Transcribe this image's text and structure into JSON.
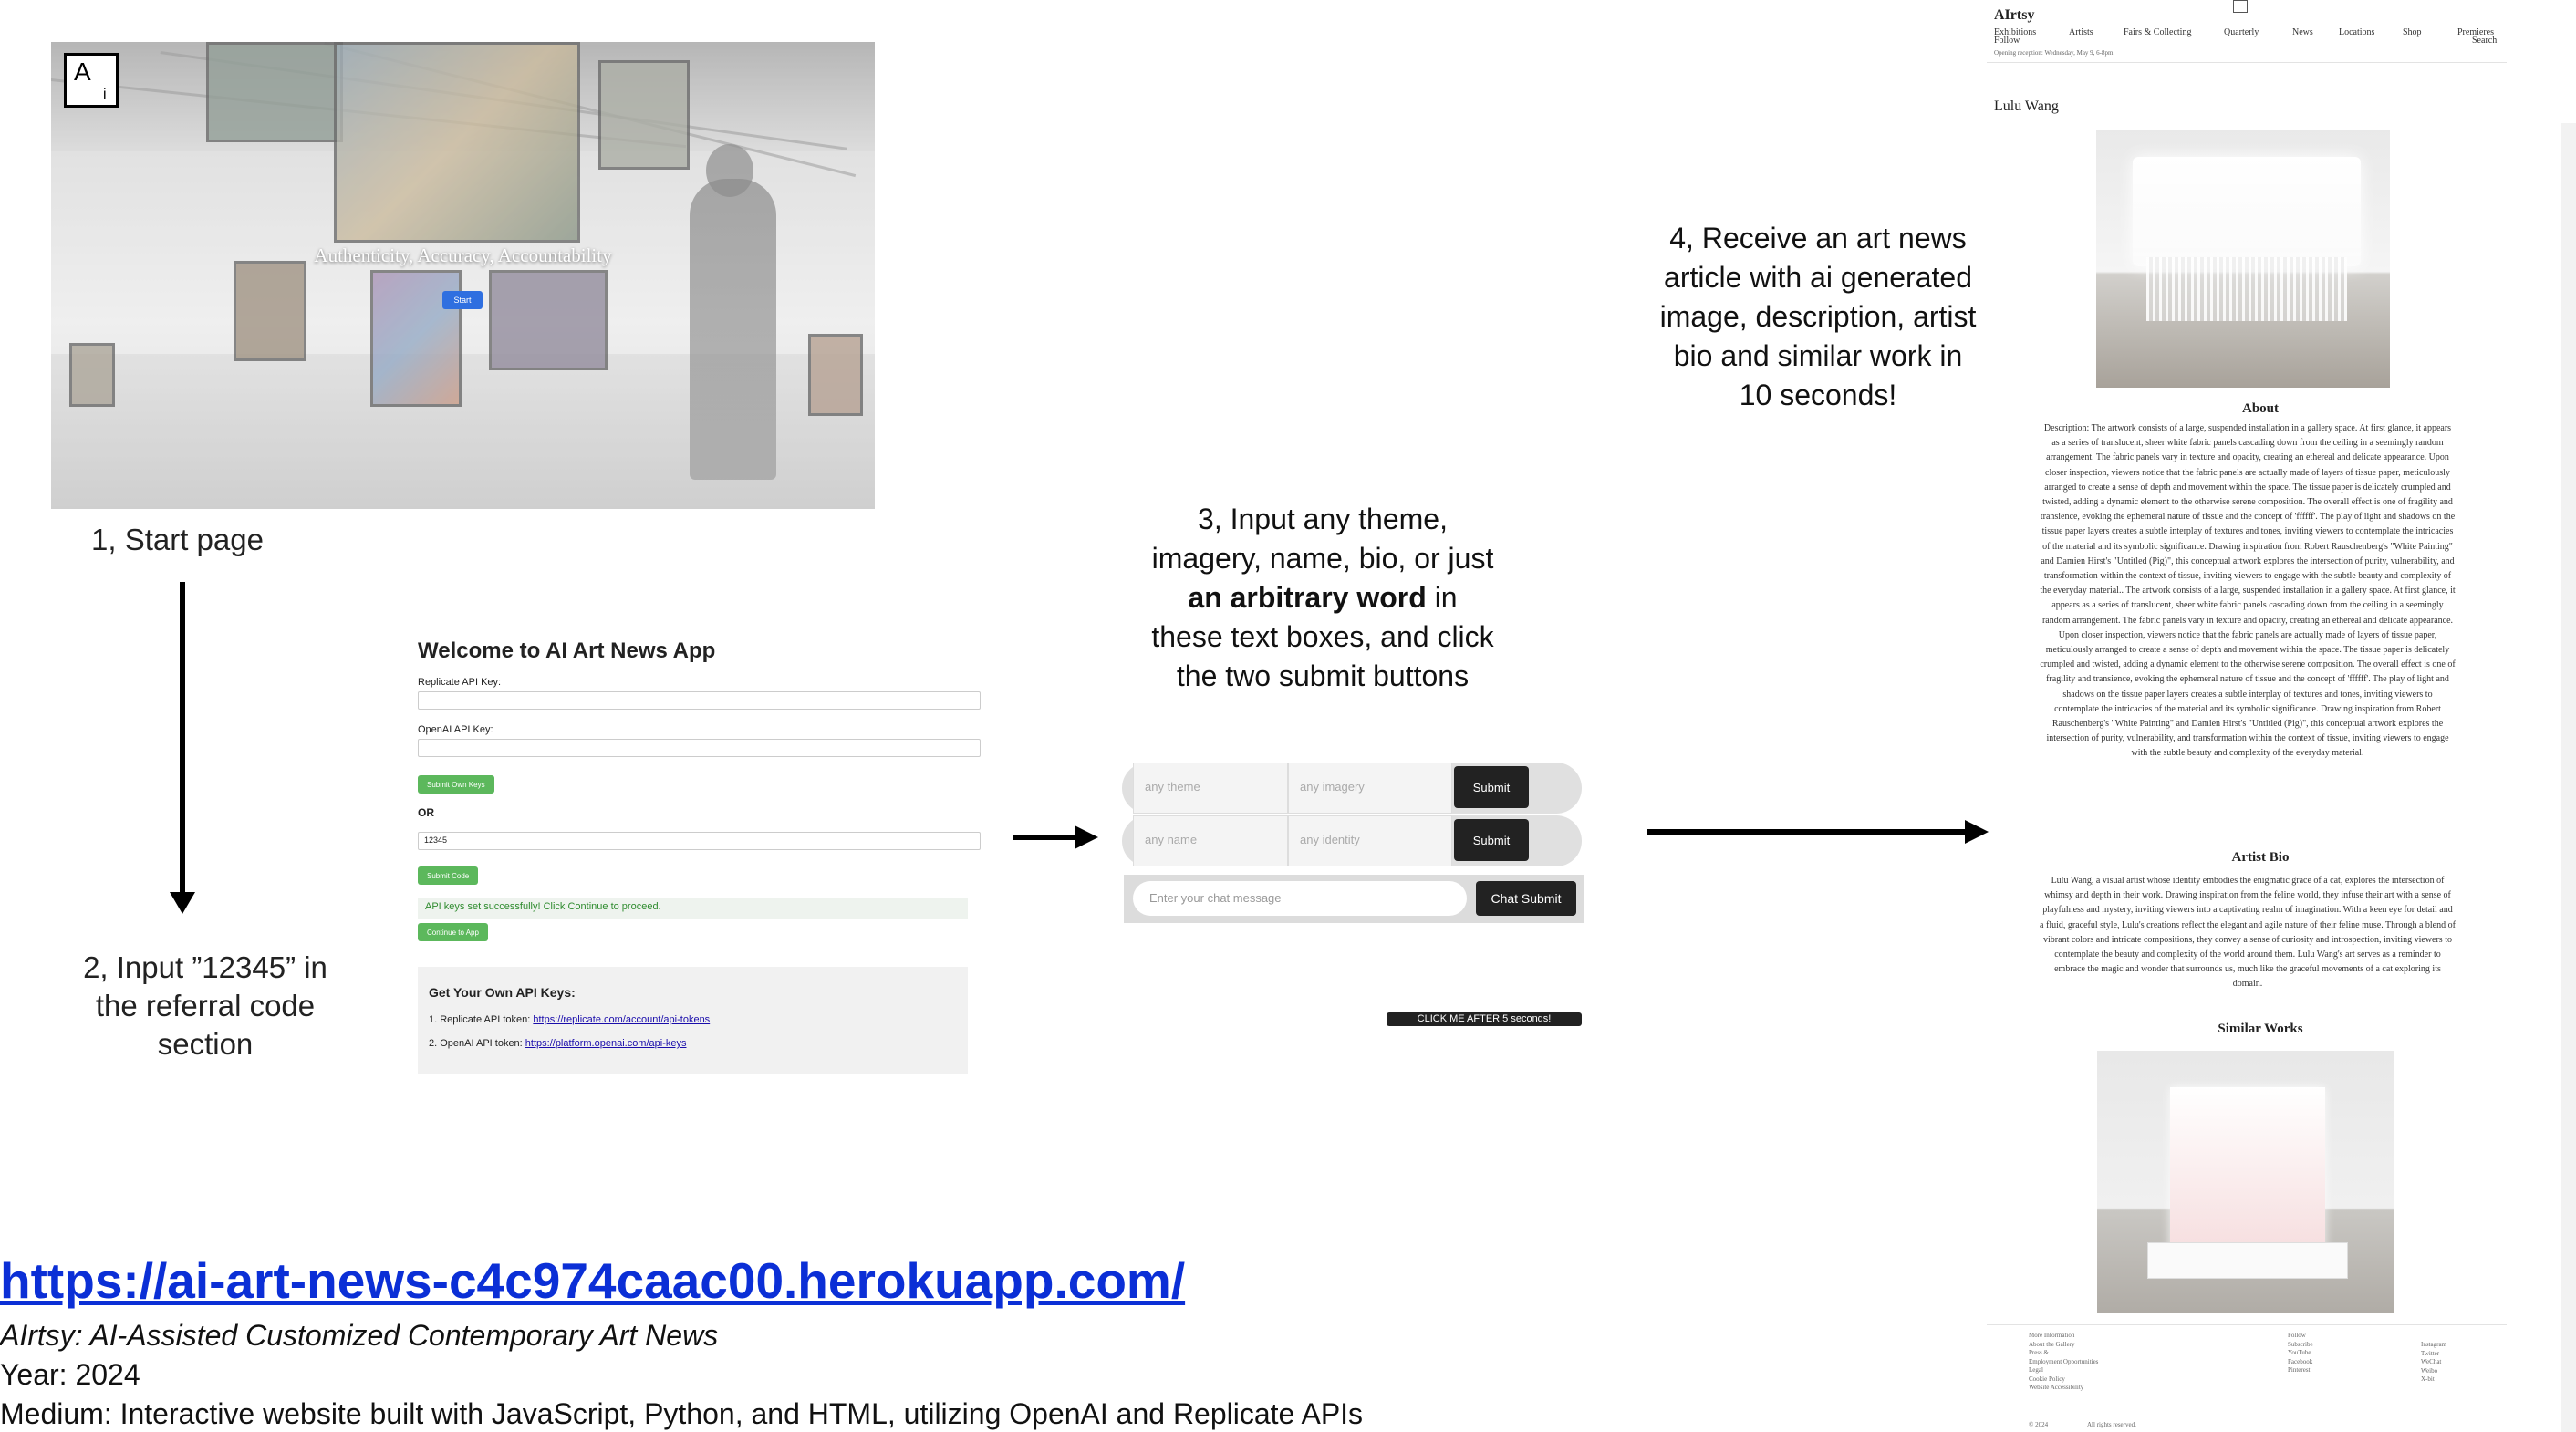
{
  "start_page": {
    "logo_main": "A",
    "logo_sub": "i",
    "tagline": "Authenticity, Accuracy, Accountability",
    "start_button": "Start"
  },
  "captions": {
    "step1": "1, Start page",
    "step2": "2, Input ”12345” in the referral code section",
    "step3_pre": "3, Input any theme, imagery, name, bio, or just",
    "step3_bold": "an arbitrary word",
    "step3_post": "in these text boxes, and click the two submit buttons",
    "step4": "4, Receive an art news article with ai generated image, description, artist bio and similar work in 10 seconds!"
  },
  "api_form": {
    "title": "Welcome to AI Art News App",
    "replicate_label": "Replicate API Key:",
    "openai_label": "OpenAI API Key:",
    "submit_own_keys": "Submit Own Keys",
    "or": "OR",
    "referral_value": "12345",
    "submit_code": "Submit Code",
    "success_message": "API keys set successfully! Click Continue to proceed.",
    "continue_button": "Continue to App",
    "get_keys_title": "Get Your Own API Keys:",
    "replicate_token_text": "1. Replicate API token:",
    "replicate_token_link": "https://replicate.com/account/api-tokens",
    "openai_token_text": "2. OpenAI API token:",
    "openai_token_link": "https://platform.openai.com/api-keys"
  },
  "input_panel": {
    "theme_placeholder": "any theme",
    "imagery_placeholder": "any imagery",
    "name_placeholder": "any name",
    "identity_placeholder": "any identity",
    "submit_1": "Submit",
    "submit_2": "Submit",
    "chat_placeholder": "Enter your chat message",
    "chat_submit": "Chat Submit",
    "click_me": "CLICK ME AFTER 5 seconds!"
  },
  "article": {
    "brand": "AIrtsy",
    "nav": [
      "Exhibitions",
      "Artists",
      "Fairs & Collecting",
      "Quarterly",
      "News",
      "Locations",
      "Shop",
      "Premieres"
    ],
    "nav_follow": "Follow",
    "nav_search": "Search",
    "opening": "Opening reception: Wednesday, May 9, 6-8pm",
    "artist_name": "Lulu Wang",
    "about_heading": "About",
    "about_text": "Description: The artwork consists of a large, suspended installation in a gallery space. At first glance, it appears as a series of translucent, sheer white fabric panels cascading down from the ceiling in a seemingly random arrangement. The fabric panels vary in texture and opacity, creating an ethereal and delicate appearance. Upon closer inspection, viewers notice that the fabric panels are actually made of layers of tissue paper, meticulously arranged to create a sense of depth and movement within the space. The tissue paper is delicately crumpled and twisted, adding a dynamic element to the otherwise serene composition. The overall effect is one of fragility and transience, evoking the ephemeral nature of tissue and the concept of 'ffffff'. The play of light and shadows on the tissue paper layers creates a subtle interplay of textures and tones, inviting viewers to contemplate the intricacies of the material and its symbolic significance. Drawing inspiration from Robert Rauschenberg's \"White Painting\" and Damien Hirst's \"Untitled (Pig)\", this conceptual artwork explores the intersection of purity, vulnerability, and transformation within the context of tissue, inviting viewers to engage with the subtle beauty and complexity of the everyday material.. The artwork consists of a large, suspended installation in a gallery space. At first glance, it appears as a series of translucent, sheer white fabric panels cascading down from the ceiling in a seemingly random arrangement. The fabric panels vary in texture and opacity, creating an ethereal and delicate appearance. Upon closer inspection, viewers notice that the fabric panels are actually made of layers of tissue paper, meticulously arranged to create a sense of depth and movement within the space. The tissue paper is delicately crumpled and twisted, adding a dynamic element to the otherwise serene composition. The overall effect is one of fragility and transience, evoking the ephemeral nature of tissue and the concept of 'ffffff'. The play of light and shadows on the tissue paper layers creates a subtle interplay of textures and tones, inviting viewers to contemplate the intricacies of the material and its symbolic significance. Drawing inspiration from Robert Rauschenberg's \"White Painting\" and Damien Hirst's \"Untitled (Pig)\", this conceptual artwork explores the intersection of purity, vulnerability, and transformation within the context of tissue, inviting viewers to engage with the subtle beauty and complexity of the everyday material.",
    "bio_heading": "Artist Bio",
    "bio_text": "Lulu Wang, a visual artist whose identity embodies the enigmatic grace of a cat, explores the intersection of whimsy and depth in their work. Drawing inspiration from the feline world, they infuse their art with a sense of playfulness and mystery, inviting viewers into a captivating realm of imagination. With a keen eye for detail and a fluid, graceful style, Lulu's creations reflect the elegant and agile nature of their feline muse. Through a blend of vibrant colors and intricate compositions, they convey a sense of curiosity and introspection, inviting viewers to contemplate the beauty and complexity of the world around them. Lulu Wang's art serves as a reminder to embrace the magic and wonder that surrounds us, much like the graceful movements of a cat exploring its domain.",
    "similar_heading": "Similar Works",
    "footer_more_title": "More Information",
    "footer_more": [
      "About the Gallery",
      "Press &",
      "Employment Opportunities",
      "Legal",
      "Cookie Policy",
      "Website Accessibility"
    ],
    "footer_follow_title": "Follow",
    "footer_follow": [
      "Subscribe",
      "YouTube",
      "Facebook",
      "Pinterest"
    ],
    "footer_social": [
      "Instagram",
      "Twitter",
      "WeChat",
      "Weibo",
      "X-bit"
    ],
    "copyright": "© 2024",
    "rights": "All rights reserved."
  },
  "footer": {
    "url": "https://ai-art-news-c4c974caac00.herokuapp.com/",
    "title": "AIrtsy: AI-Assisted Customized Contemporary Art News",
    "year": "Year: 2024",
    "medium": "Medium: Interactive  website built with JavaScript, Python, and HTML, utilizing OpenAI and Replicate APIs"
  }
}
